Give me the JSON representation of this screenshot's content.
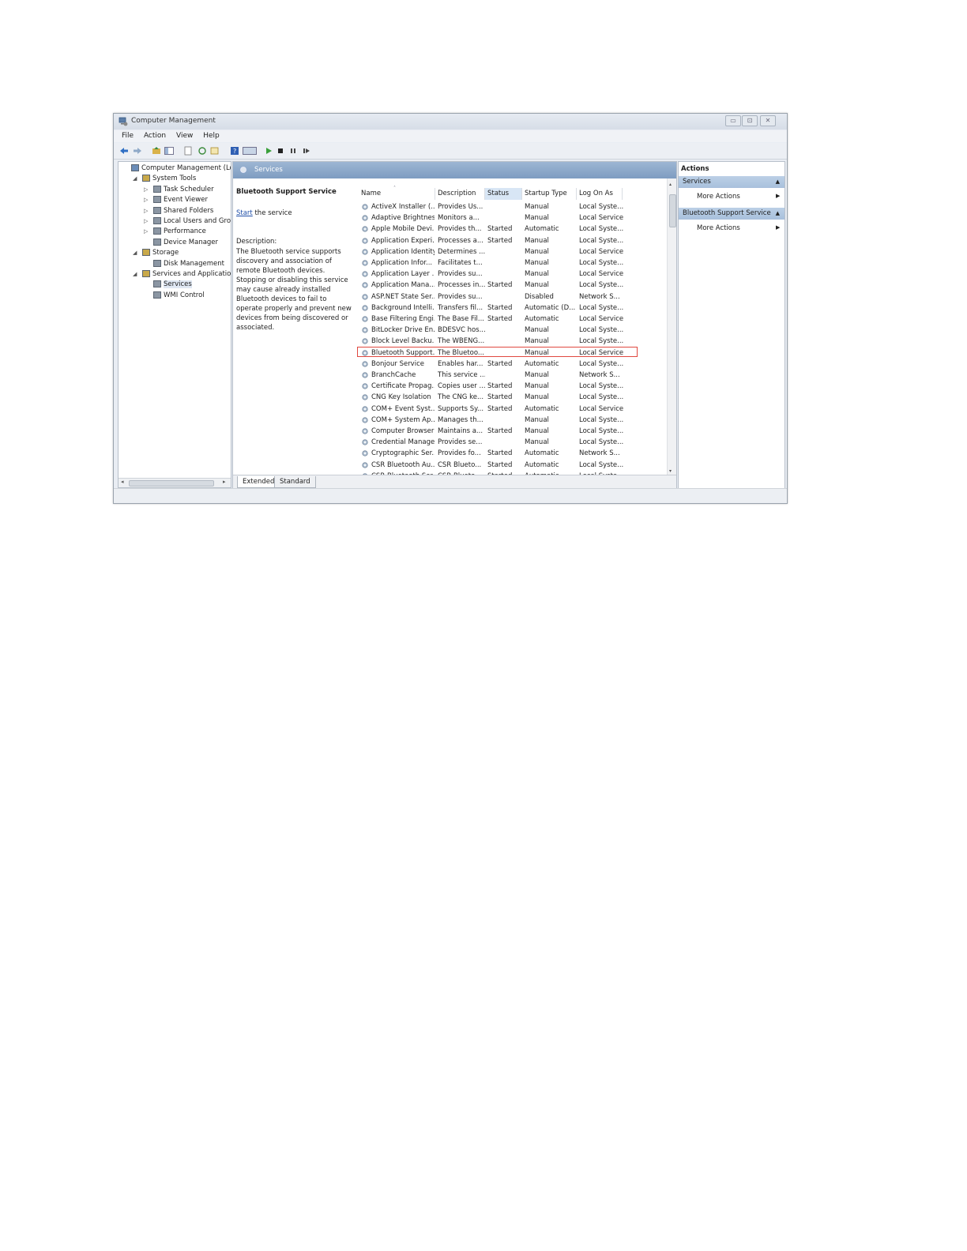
{
  "window": {
    "title": "Computer Management"
  },
  "menu": [
    "File",
    "Action",
    "View",
    "Help"
  ],
  "tree": [
    {
      "label": "Computer Management (Local",
      "level": 0,
      "expander": ""
    },
    {
      "label": "System Tools",
      "level": 1,
      "expander": "◢"
    },
    {
      "label": "Task Scheduler",
      "level": 2,
      "expander": "▷"
    },
    {
      "label": "Event Viewer",
      "level": 2,
      "expander": "▷"
    },
    {
      "label": "Shared Folders",
      "level": 2,
      "expander": "▷"
    },
    {
      "label": "Local Users and Groups",
      "level": 2,
      "expander": "▷"
    },
    {
      "label": "Performance",
      "level": 2,
      "expander": "▷"
    },
    {
      "label": "Device Manager",
      "level": 2,
      "expander": ""
    },
    {
      "label": "Storage",
      "level": 1,
      "expander": "◢"
    },
    {
      "label": "Disk Management",
      "level": 2,
      "expander": ""
    },
    {
      "label": "Services and Applications",
      "level": 1,
      "expander": "◢"
    },
    {
      "label": "Services",
      "level": 2,
      "expander": ""
    },
    {
      "label": "WMI Control",
      "level": 2,
      "expander": ""
    }
  ],
  "center_header": "Services",
  "detail": {
    "title": "Bluetooth Support Service",
    "start_link": "Start",
    "start_rest": " the service",
    "description_label": "Description:",
    "description": "The Bluetooth service supports discovery and association of remote Bluetooth devices.  Stopping or disabling this service may cause already installed Bluetooth devices to fail to operate properly and prevent new devices from being discovered or associated."
  },
  "columns": [
    "Name",
    "Description",
    "Status",
    "Startup Type",
    "Log On As"
  ],
  "services": [
    [
      "ActiveX Installer (...",
      "Provides Us...",
      "",
      "Manual",
      "Local Syste..."
    ],
    [
      "Adaptive Brightness",
      "Monitors a...",
      "",
      "Manual",
      "Local Service"
    ],
    [
      "Apple Mobile Devi...",
      "Provides th...",
      "Started",
      "Automatic",
      "Local Syste..."
    ],
    [
      "Application Experi...",
      "Processes a...",
      "Started",
      "Manual",
      "Local Syste..."
    ],
    [
      "Application Identity",
      "Determines ...",
      "",
      "Manual",
      "Local Service"
    ],
    [
      "Application Infor...",
      "Facilitates t...",
      "",
      "Manual",
      "Local Syste..."
    ],
    [
      "Application Layer ...",
      "Provides su...",
      "",
      "Manual",
      "Local Service"
    ],
    [
      "Application Mana...",
      "Processes in...",
      "Started",
      "Manual",
      "Local Syste..."
    ],
    [
      "ASP.NET State Ser...",
      "Provides su...",
      "",
      "Disabled",
      "Network S..."
    ],
    [
      "Background Intelli...",
      "Transfers fil...",
      "Started",
      "Automatic (D...",
      "Local Syste..."
    ],
    [
      "Base Filtering Engi...",
      "The Base Fil...",
      "Started",
      "Automatic",
      "Local Service"
    ],
    [
      "BitLocker Drive En...",
      "BDESVC hos...",
      "",
      "Manual",
      "Local Syste..."
    ],
    [
      "Block Level Backu...",
      "The WBENG...",
      "",
      "Manual",
      "Local Syste..."
    ],
    [
      "Bluetooth Support...",
      "The Bluetoo...",
      "",
      "Manual",
      "Local Service"
    ],
    [
      "Bonjour Service",
      "Enables har...",
      "Started",
      "Automatic",
      "Local Syste..."
    ],
    [
      "BranchCache",
      "This service ...",
      "",
      "Manual",
      "Network S..."
    ],
    [
      "Certificate Propag...",
      "Copies user ...",
      "Started",
      "Manual",
      "Local Syste..."
    ],
    [
      "CNG Key Isolation",
      "The CNG ke...",
      "Started",
      "Manual",
      "Local Syste..."
    ],
    [
      "COM+ Event Syst...",
      "Supports Sy...",
      "Started",
      "Automatic",
      "Local Service"
    ],
    [
      "COM+ System Ap...",
      "Manages th...",
      "",
      "Manual",
      "Local Syste..."
    ],
    [
      "Computer Browser",
      "Maintains a...",
      "Started",
      "Manual",
      "Local Syste..."
    ],
    [
      "Credential Manager",
      "Provides se...",
      "",
      "Manual",
      "Local Syste..."
    ],
    [
      "Cryptographic Ser...",
      "Provides fo...",
      "Started",
      "Automatic",
      "Network S..."
    ],
    [
      "CSR Bluetooth Au...",
      "CSR Blueto...",
      "Started",
      "Automatic",
      "Local Syste..."
    ],
    [
      "CSR Bluetooth Ser...",
      "CSR Blueto...",
      "Started",
      "Automatic",
      "Local Syste..."
    ]
  ],
  "selected_index": 13,
  "tabs": [
    "Extended",
    "Standard"
  ],
  "actions": {
    "title": "Actions",
    "groups": [
      {
        "label": "Services",
        "item": "More Actions"
      },
      {
        "label": "Bluetooth Support Service",
        "item": "More Actions"
      }
    ]
  },
  "colors": {
    "header": "#8aa6c8",
    "selection_outline": "#e0483f",
    "link": "#1f4ea8"
  }
}
